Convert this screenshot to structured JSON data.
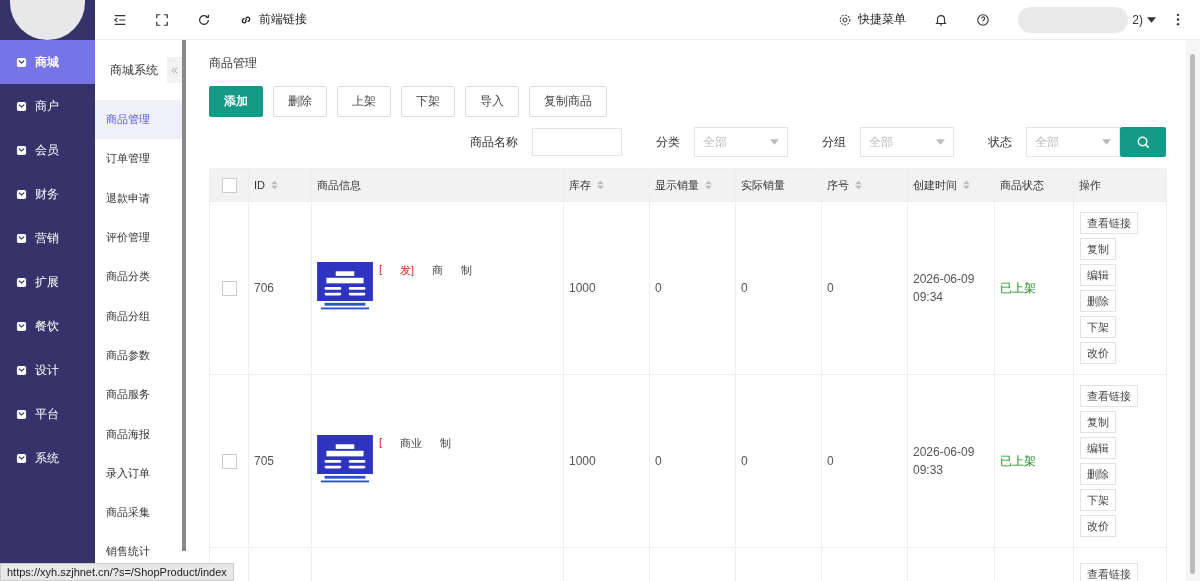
{
  "topbar": {
    "link_label": "前端链接",
    "quick_menu": "快捷菜单",
    "user_suffix": "2)"
  },
  "nav": [
    {
      "label": "商城",
      "selected": true
    },
    {
      "label": "商户",
      "selected": false
    },
    {
      "label": "会员",
      "selected": false
    },
    {
      "label": "财务",
      "selected": false
    },
    {
      "label": "营销",
      "selected": false
    },
    {
      "label": "扩展",
      "selected": false
    },
    {
      "label": "餐饮",
      "selected": false
    },
    {
      "label": "设计",
      "selected": false
    },
    {
      "label": "平台",
      "selected": false
    },
    {
      "label": "系统",
      "selected": false
    }
  ],
  "submenu": {
    "title": "商城系统",
    "items": [
      {
        "label": "商品管理",
        "selected": true
      },
      {
        "label": "订单管理",
        "selected": false
      },
      {
        "label": "退款申请",
        "selected": false
      },
      {
        "label": "评价管理",
        "selected": false
      },
      {
        "label": "商品分类",
        "selected": false
      },
      {
        "label": "商品分组",
        "selected": false
      },
      {
        "label": "商品参数",
        "selected": false
      },
      {
        "label": "商品服务",
        "selected": false
      },
      {
        "label": "商品海报",
        "selected": false
      },
      {
        "label": "录入订单",
        "selected": false
      },
      {
        "label": "商品采集",
        "selected": false
      },
      {
        "label": "销售统计",
        "selected": false
      }
    ]
  },
  "page_title": "商品管理",
  "actions": [
    {
      "label": "添加",
      "kind": "primary"
    },
    {
      "label": "删除",
      "kind": "plain"
    },
    {
      "label": "上架",
      "kind": "plain"
    },
    {
      "label": "下架",
      "kind": "plain"
    },
    {
      "label": "导入",
      "kind": "plain"
    },
    {
      "label": "复制商品",
      "kind": "plain"
    }
  ],
  "filters": [
    {
      "label": "商品名称",
      "kind": "text"
    },
    {
      "label": "分类",
      "kind": "select",
      "placeholder": "全部"
    },
    {
      "label": "分组",
      "kind": "select",
      "placeholder": "全部"
    },
    {
      "label": "状态",
      "kind": "select",
      "placeholder": "全部"
    }
  ],
  "table": {
    "select_all": {
      "checked": false
    },
    "columns": [
      {
        "label": "ID",
        "sortable": true
      },
      {
        "label": "商品信息",
        "sortable": false
      },
      {
        "label": "库存",
        "sortable": true
      },
      {
        "label": "显示销量",
        "sortable": true
      },
      {
        "label": "实际销量",
        "sortable": false
      },
      {
        "label": "序号",
        "sortable": true
      },
      {
        "label": "创建时间",
        "sortable": true
      },
      {
        "label": "商品状态",
        "sortable": false
      },
      {
        "label": "操作",
        "sortable": false
      }
    ],
    "rows": [
      {
        "checked": false,
        "id": "706",
        "thumb": {
          "kind": "picture"
        },
        "title_parts": [
          {
            "text": "[",
            "kind": "tag"
          },
          {
            "text": "发]",
            "kind": "tag"
          },
          {
            "text": "商",
            "kind": "plain"
          },
          {
            "text": "制",
            "kind": "plain"
          }
        ],
        "stock": "1000",
        "shown_sales": "0",
        "real_sales": "0",
        "order": "0",
        "created": "2026-06-09 09:34",
        "status": "已上架",
        "actions": [
          "查看链接",
          "复制",
          "编辑",
          "删除",
          "下架",
          "改价"
        ]
      },
      {
        "checked": false,
        "id": "705",
        "thumb": {
          "kind": "picture"
        },
        "title_parts": [
          {
            "text": "[",
            "kind": "tag"
          },
          {
            "text": "商业",
            "kind": "plain"
          },
          {
            "text": "制",
            "kind": "plain"
          }
        ],
        "stock": "1000",
        "shown_sales": "0",
        "real_sales": "0",
        "order": "0",
        "created": "2026-06-09 09:33",
        "status": "已上架",
        "actions": [
          "查看链接",
          "复制",
          "编辑",
          "删除",
          "下架",
          "改价"
        ]
      },
      {
        "actions": [
          "查看链接"
        ]
      }
    ]
  },
  "status_bar": "https://xyh.szjhnet.cn/?s=/ShopProduct/index"
}
